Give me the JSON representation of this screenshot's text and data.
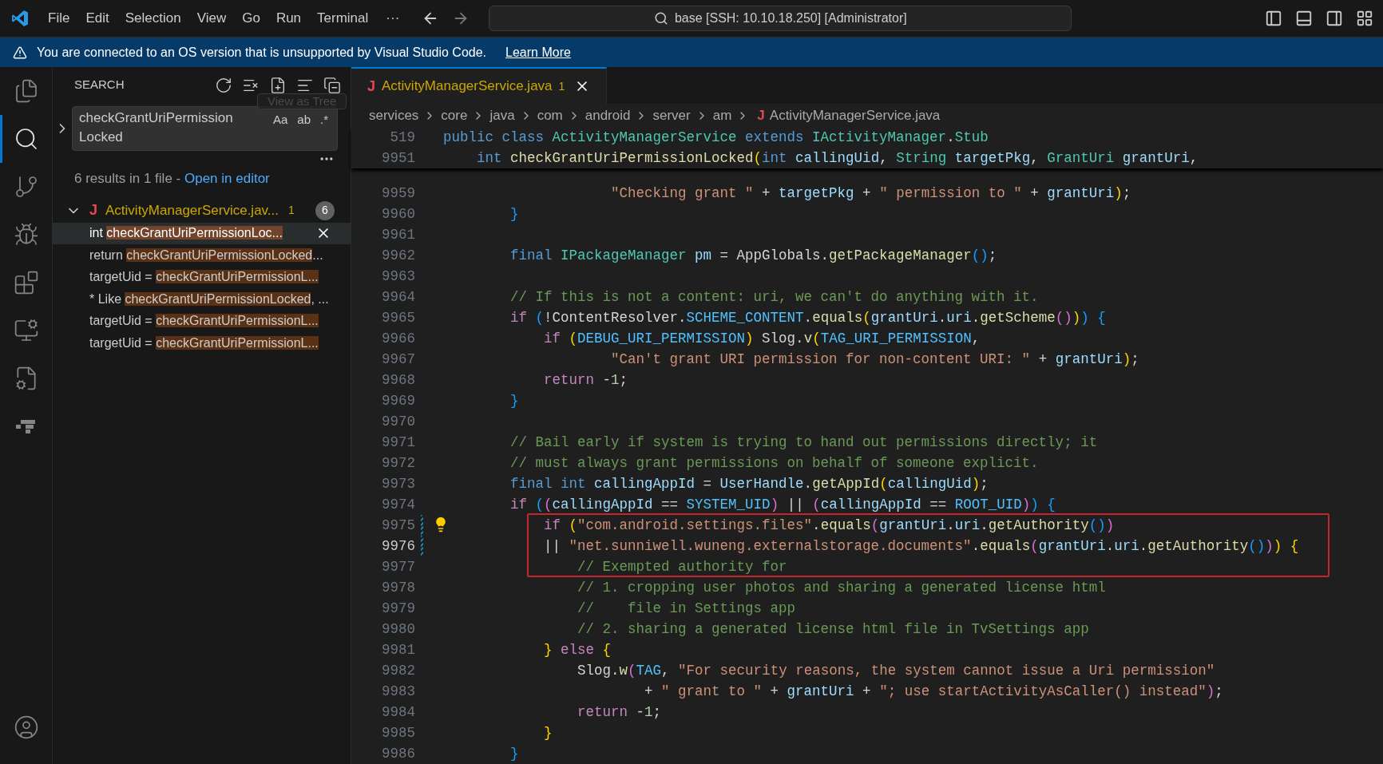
{
  "title_bar": {
    "menus": [
      "File",
      "Edit",
      "Selection",
      "View",
      "Go",
      "Run",
      "Terminal"
    ],
    "more": "···",
    "command_center": "base [SSH: 10.10.18.250] [Administrator]"
  },
  "banner": {
    "message": "You are connected to an OS version that is unsupported by Visual Studio Code.",
    "link": "Learn More"
  },
  "activity_bar": [
    {
      "kind": "files",
      "selected": false
    },
    {
      "kind": "search",
      "selected": true
    },
    {
      "kind": "source-control",
      "selected": false
    },
    {
      "kind": "run-debug",
      "selected": false
    },
    {
      "kind": "extensions",
      "selected": false
    },
    {
      "kind": "remote",
      "selected": false
    },
    {
      "kind": "file-gear",
      "selected": false
    },
    {
      "kind": "blocks",
      "selected": false
    },
    {
      "kind": "account",
      "selected": false
    }
  ],
  "sidebar": {
    "title": "SEARCH",
    "tooltip": "View as Tree",
    "query": "checkGrantUriPermissionLocked",
    "options": [
      {
        "label": "Aa",
        "selected": false
      },
      {
        "label": "ab",
        "selected": false
      },
      {
        "label": ".*",
        "selected": false
      }
    ],
    "summary": "6 results in 1 file - ",
    "summary_link": "Open in editor",
    "file": {
      "icon_letter": "J",
      "name": "ActivityManagerService.jav...",
      "problems": "1",
      "count": "6",
      "expanded": true
    },
    "results": [
      {
        "prefix": "int ",
        "match": "checkGrantUriPermissionLoc...",
        "selected": true
      },
      {
        "prefix": "return ",
        "match": "checkGrantUriPermissionLocked",
        "suffix": "...",
        "selected": false
      },
      {
        "prefix": "targetUid = ",
        "match": "checkGrantUriPermissionL...",
        "selected": false
      },
      {
        "prefix": "* Like ",
        "match": "checkGrantUriPermissionLocked",
        "suffix": ", ...",
        "selected": false
      },
      {
        "prefix": "targetUid = ",
        "match": "checkGrantUriPermissionL...",
        "selected": false
      },
      {
        "prefix": "targetUid = ",
        "match": "checkGrantUriPermissionL...",
        "selected": false
      }
    ]
  },
  "editor": {
    "tab": {
      "icon_letter": "J",
      "title": "ActivityManagerService.java",
      "problems": "1",
      "selected": true
    },
    "breadcrumbs": [
      "services",
      "core",
      "java",
      "com",
      "android",
      "server",
      "am"
    ],
    "breadcrumb_file": {
      "icon_letter": "J",
      "name": "ActivityManagerService.java"
    },
    "sticky_lines": [
      {
        "number": "519",
        "tokens": [
          {
            "kind": "k",
            "text": "public class"
          },
          {
            "kind": "t",
            "text": " ActivityManagerService"
          },
          {
            "kind": "k",
            "text": " extends"
          },
          {
            "kind": "t",
            "text": " IActivityManager"
          },
          {
            "kind": "p",
            "text": "."
          },
          {
            "kind": "t",
            "text": "Stub"
          }
        ]
      },
      {
        "number": "9951",
        "tokens": [
          {
            "kind": "k",
            "text": "    int"
          },
          {
            "kind": "f",
            "text": " checkGrantUriPermissionLocked"
          },
          {
            "kind": "b1",
            "text": "("
          },
          {
            "kind": "k",
            "text": "int"
          },
          {
            "kind": "v",
            "text": " callingUid"
          },
          {
            "kind": "p",
            "text": ","
          },
          {
            "kind": "t",
            "text": " String"
          },
          {
            "kind": "v",
            "text": " targetPkg"
          },
          {
            "kind": "p",
            "text": ","
          },
          {
            "kind": "t",
            "text": " GrantUri"
          },
          {
            "kind": "v",
            "text": " grantUri"
          },
          {
            "kind": "p",
            "text": ","
          }
        ]
      }
    ],
    "lines": [
      {
        "number": "9959",
        "active": false,
        "modified": false,
        "lightbulb": false,
        "boxed": false,
        "tokens": [
          {
            "kind": "s",
            "text": "                    \"Checking grant \""
          },
          {
            "kind": "p",
            "text": " + "
          },
          {
            "kind": "v",
            "text": "targetPkg"
          },
          {
            "kind": "p",
            "text": " + "
          },
          {
            "kind": "s",
            "text": "\" permission to \""
          },
          {
            "kind": "p",
            "text": " + "
          },
          {
            "kind": "v",
            "text": "grantUri"
          },
          {
            "kind": "b1",
            "text": ")"
          },
          {
            "kind": "p",
            "text": ";"
          }
        ]
      },
      {
        "number": "9960",
        "active": false,
        "modified": false,
        "lightbulb": false,
        "boxed": false,
        "tokens": [
          {
            "kind": "b3",
            "text": "        }"
          }
        ]
      },
      {
        "number": "9961",
        "active": false,
        "modified": false,
        "lightbulb": false,
        "boxed": false
      },
      {
        "number": "9962",
        "active": false,
        "modified": false,
        "lightbulb": false,
        "boxed": false,
        "tokens": [
          {
            "kind": "k",
            "text": "        final"
          },
          {
            "kind": "t",
            "text": " IPackageManager"
          },
          {
            "kind": "v",
            "text": " pm"
          },
          {
            "kind": "p",
            "text": " = AppGlobals."
          },
          {
            "kind": "f",
            "text": "getPackageManager"
          },
          {
            "kind": "b3",
            "text": "()"
          },
          {
            "kind": "p",
            "text": ";"
          }
        ]
      },
      {
        "number": "9963",
        "active": false,
        "modified": false,
        "lightbulb": false,
        "boxed": false
      },
      {
        "number": "9964",
        "active": false,
        "modified": false,
        "lightbulb": false,
        "boxed": false,
        "tokens": [
          {
            "kind": "c",
            "text": "        // If this is not a content: uri, we can't do anything with it."
          }
        ]
      },
      {
        "number": "9965",
        "active": false,
        "modified": false,
        "lightbulb": false,
        "boxed": false,
        "tokens": [
          {
            "kind": "ctl",
            "text": "        if"
          },
          {
            "kind": "b3",
            "text": " ("
          },
          {
            "kind": "p",
            "text": "!ContentResolver."
          },
          {
            "kind": "const",
            "text": "SCHEME_CONTENT"
          },
          {
            "kind": "p",
            "text": "."
          },
          {
            "kind": "f",
            "text": "equals"
          },
          {
            "kind": "b1",
            "text": "("
          },
          {
            "kind": "v",
            "text": "grantUri"
          },
          {
            "kind": "p",
            "text": "."
          },
          {
            "kind": "v",
            "text": "uri"
          },
          {
            "kind": "p",
            "text": "."
          },
          {
            "kind": "f",
            "text": "getScheme"
          },
          {
            "kind": "b2",
            "text": "()"
          },
          {
            "kind": "b1",
            "text": ")"
          },
          {
            "kind": "b3",
            "text": ") {"
          }
        ]
      },
      {
        "number": "9966",
        "active": false,
        "modified": false,
        "lightbulb": false,
        "boxed": false,
        "tokens": [
          {
            "kind": "ctl",
            "text": "            if"
          },
          {
            "kind": "b1",
            "text": " ("
          },
          {
            "kind": "const",
            "text": "DEBUG_URI_PERMISSION"
          },
          {
            "kind": "b1",
            "text": ")"
          },
          {
            "kind": "p",
            "text": " Slog."
          },
          {
            "kind": "f",
            "text": "v"
          },
          {
            "kind": "b1",
            "text": "("
          },
          {
            "kind": "const",
            "text": "TAG_URI_PERMISSION"
          },
          {
            "kind": "p",
            "text": ","
          }
        ]
      },
      {
        "number": "9967",
        "active": false,
        "modified": false,
        "lightbulb": false,
        "boxed": false,
        "tokens": [
          {
            "kind": "s",
            "text": "                    \"Can't grant URI permission for non-content URI: \""
          },
          {
            "kind": "p",
            "text": " + "
          },
          {
            "kind": "v",
            "text": "grantUri"
          },
          {
            "kind": "b1",
            "text": ")"
          },
          {
            "kind": "p",
            "text": ";"
          }
        ]
      },
      {
        "number": "9968",
        "active": false,
        "modified": false,
        "lightbulb": false,
        "boxed": false,
        "tokens": [
          {
            "kind": "ctl",
            "text": "            return"
          },
          {
            "kind": "p",
            "text": " -"
          },
          {
            "kind": "n",
            "text": "1"
          },
          {
            "kind": "p",
            "text": ";"
          }
        ]
      },
      {
        "number": "9969",
        "active": false,
        "modified": false,
        "lightbulb": false,
        "boxed": false,
        "tokens": [
          {
            "kind": "b3",
            "text": "        }"
          }
        ]
      },
      {
        "number": "9970",
        "active": false,
        "modified": false,
        "lightbulb": false,
        "boxed": false
      },
      {
        "number": "9971",
        "active": false,
        "modified": false,
        "lightbulb": false,
        "boxed": false,
        "tokens": [
          {
            "kind": "c",
            "text": "        // Bail early if system is trying to hand out permissions directly; it"
          }
        ]
      },
      {
        "number": "9972",
        "active": false,
        "modified": false,
        "lightbulb": false,
        "boxed": false,
        "tokens": [
          {
            "kind": "c",
            "text": "        // must always grant permissions on behalf of someone explicit."
          }
        ]
      },
      {
        "number": "9973",
        "active": false,
        "modified": false,
        "lightbulb": false,
        "boxed": false,
        "tokens": [
          {
            "kind": "k",
            "text": "        final int"
          },
          {
            "kind": "v",
            "text": " callingAppId"
          },
          {
            "kind": "p",
            "text": " = "
          },
          {
            "kind": "v",
            "text": "UserHandle"
          },
          {
            "kind": "p",
            "text": "."
          },
          {
            "kind": "f",
            "text": "getAppId"
          },
          {
            "kind": "b1",
            "text": "("
          },
          {
            "kind": "v",
            "text": "callingUid"
          },
          {
            "kind": "b1",
            "text": ")"
          },
          {
            "kind": "p",
            "text": ";"
          }
        ]
      },
      {
        "number": "9974",
        "active": false,
        "modified": false,
        "lightbulb": false,
        "boxed": false,
        "tokens": [
          {
            "kind": "ctl",
            "text": "        if"
          },
          {
            "kind": "b3",
            "text": " ("
          },
          {
            "kind": "b2",
            "text": "("
          },
          {
            "kind": "v",
            "text": "callingAppId"
          },
          {
            "kind": "p",
            "text": " == "
          },
          {
            "kind": "const",
            "text": "SYSTEM_UID"
          },
          {
            "kind": "b2",
            "text": ")"
          },
          {
            "kind": "p",
            "text": " || "
          },
          {
            "kind": "b2",
            "text": "("
          },
          {
            "kind": "v",
            "text": "callingAppId"
          },
          {
            "kind": "p",
            "text": " == "
          },
          {
            "kind": "const",
            "text": "ROOT_UID"
          },
          {
            "kind": "b2",
            "text": ")"
          },
          {
            "kind": "b3",
            "text": ") {"
          }
        ]
      },
      {
        "number": "9975",
        "active": false,
        "modified": true,
        "lightbulb": true,
        "boxed": true,
        "tokens": [
          {
            "kind": "ctl",
            "text": "            if"
          },
          {
            "kind": "b1",
            "text": " ("
          },
          {
            "kind": "s",
            "text": "\"com.android.settings.files\""
          },
          {
            "kind": "p",
            "text": "."
          },
          {
            "kind": "f",
            "text": "equals"
          },
          {
            "kind": "b2",
            "text": "("
          },
          {
            "kind": "v",
            "text": "grantUri"
          },
          {
            "kind": "p",
            "text": "."
          },
          {
            "kind": "v",
            "text": "uri"
          },
          {
            "kind": "p",
            "text": "."
          },
          {
            "kind": "f",
            "text": "getAuthority"
          },
          {
            "kind": "b3",
            "text": "()"
          },
          {
            "kind": "b2",
            "text": ")"
          }
        ]
      },
      {
        "number": "9976",
        "active": true,
        "modified": true,
        "lightbulb": false,
        "boxed": true,
        "tokens": [
          {
            "kind": "p",
            "text": "            || "
          },
          {
            "kind": "s",
            "text": "\"net.sunniwell.wuneng.externalstorage.documents\""
          },
          {
            "kind": "p",
            "text": "."
          },
          {
            "kind": "f",
            "text": "equals"
          },
          {
            "kind": "b2",
            "text": "("
          },
          {
            "kind": "v",
            "text": "grantUri"
          },
          {
            "kind": "p",
            "text": "."
          },
          {
            "kind": "v",
            "text": "uri"
          },
          {
            "kind": "p",
            "text": "."
          },
          {
            "kind": "f",
            "text": "getAuthority"
          },
          {
            "kind": "b3",
            "text": "()"
          },
          {
            "kind": "b2",
            "text": ")"
          },
          {
            "kind": "b1",
            "text": ") {"
          }
        ]
      },
      {
        "number": "9977",
        "active": false,
        "modified": false,
        "lightbulb": false,
        "boxed": true,
        "tokens": [
          {
            "kind": "c",
            "text": "                // Exempted authority for"
          }
        ]
      },
      {
        "number": "9978",
        "active": false,
        "modified": false,
        "lightbulb": false,
        "boxed": false,
        "tokens": [
          {
            "kind": "c",
            "text": "                // 1. cropping user photos and sharing a generated license html"
          }
        ]
      },
      {
        "number": "9979",
        "active": false,
        "modified": false,
        "lightbulb": false,
        "boxed": false,
        "tokens": [
          {
            "kind": "c",
            "text": "                //    file in Settings app"
          }
        ]
      },
      {
        "number": "9980",
        "active": false,
        "modified": false,
        "lightbulb": false,
        "boxed": false,
        "tokens": [
          {
            "kind": "c",
            "text": "                // 2. sharing a generated license html file in TvSettings app"
          }
        ]
      },
      {
        "number": "9981",
        "active": false,
        "modified": false,
        "lightbulb": false,
        "boxed": false,
        "tokens": [
          {
            "kind": "b1",
            "text": "            }"
          },
          {
            "kind": "ctl",
            "text": " else"
          },
          {
            "kind": "b1",
            "text": " {"
          }
        ]
      },
      {
        "number": "9982",
        "active": false,
        "modified": false,
        "lightbulb": false,
        "boxed": false,
        "tokens": [
          {
            "kind": "p",
            "text": "                Slog."
          },
          {
            "kind": "f",
            "text": "w"
          },
          {
            "kind": "b2",
            "text": "("
          },
          {
            "kind": "const",
            "text": "TAG"
          },
          {
            "kind": "p",
            "text": ", "
          },
          {
            "kind": "s",
            "text": "\"For security reasons, the system cannot issue a Uri permission\""
          }
        ]
      },
      {
        "number": "9983",
        "active": false,
        "modified": false,
        "lightbulb": false,
        "boxed": false,
        "tokens": [
          {
            "kind": "p",
            "text": "                        + "
          },
          {
            "kind": "s",
            "text": "\" grant to \""
          },
          {
            "kind": "p",
            "text": " + "
          },
          {
            "kind": "v",
            "text": "grantUri"
          },
          {
            "kind": "p",
            "text": " + "
          },
          {
            "kind": "s",
            "text": "\"; use startActivityAsCaller() instead\""
          },
          {
            "kind": "b2",
            "text": ")"
          },
          {
            "kind": "p",
            "text": ";"
          }
        ]
      },
      {
        "number": "9984",
        "active": false,
        "modified": false,
        "lightbulb": false,
        "boxed": false,
        "tokens": [
          {
            "kind": "ctl",
            "text": "                return"
          },
          {
            "kind": "p",
            "text": " -"
          },
          {
            "kind": "n",
            "text": "1"
          },
          {
            "kind": "p",
            "text": ";"
          }
        ]
      },
      {
        "number": "9985",
        "active": false,
        "modified": false,
        "lightbulb": false,
        "boxed": false,
        "tokens": [
          {
            "kind": "b1",
            "text": "            }"
          }
        ]
      },
      {
        "number": "9986",
        "active": false,
        "modified": false,
        "lightbulb": false,
        "boxed": false,
        "tokens": [
          {
            "kind": "b3",
            "text": "        }"
          }
        ]
      }
    ]
  }
}
